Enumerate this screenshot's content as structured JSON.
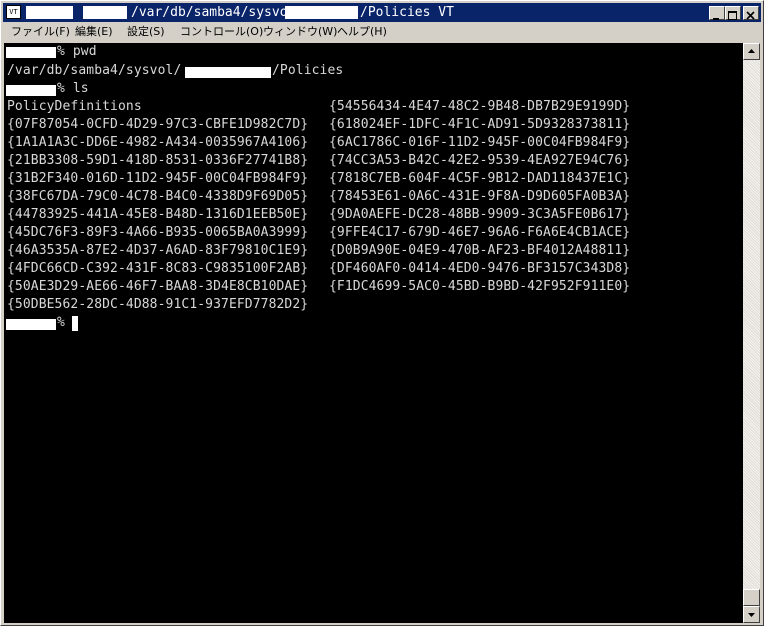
{
  "window": {
    "icon_label": "VT",
    "title_part1": "/var/db/samba4/sysvol/",
    "title_part2": "/Policies VT"
  },
  "menu": {
    "file": "ファイル(F)",
    "edit": "編集(E)",
    "settings": "設定(S)",
    "control": "コントロール(O)",
    "window": "ウィンドウ(W)",
    "help": "ヘルプ(H)"
  },
  "terminal": {
    "prompt1": "% pwd",
    "pwd_part1": "/var/db/samba4/sysvol/",
    "pwd_part2": "/Policies",
    "prompt2": "% ls",
    "prompt3": "%",
    "left_col": [
      "PolicyDefinitions",
      "{07F87054-0CFD-4D29-97C3-CBFE1D982C7D}",
      "{1A1A1A3C-DD6E-4982-A434-0035967A4106}",
      "{21BB3308-59D1-418D-8531-0336F27741B8}",
      "{31B2F340-016D-11D2-945F-00C04FB984F9}",
      "{38FC67DA-79C0-4C78-B4C0-4338D9F69D05}",
      "{44783925-441A-45E8-B48D-1316D1EEB50E}",
      "{45DC76F3-89F3-4A66-B935-0065BA0A3999}",
      "{46A3535A-87E2-4D37-A6AD-83F79810C1E9}",
      "{4FDC66CD-C392-431F-8C83-C9835100F2AB}",
      "{50AE3D29-AE66-46F7-BAA8-3D4E8CB10DAE}",
      "{50DBE562-28DC-4D88-91C1-937EFD7782D2}"
    ],
    "right_col": [
      "{54556434-4E47-48C2-9B48-DB7B29E9199D}",
      "{618024EF-1DFC-4F1C-AD91-5D9328373811}",
      "{6AC1786C-016F-11D2-945F-00C04FB984F9}",
      "{74CC3A53-B42C-42E2-9539-4EA927E94C76}",
      "{7818C7EB-604F-4C5F-9B12-DAD118437E1C}",
      "{78453E61-0A6C-431E-9F8A-D9D605FA0B3A}",
      "{9DA0AEFE-DC28-48BB-9909-3C3A5FE0B617}",
      "{9FFE4C17-679D-46E7-96A6-F6A6E4CB1ACE}",
      "{D0B9A90E-04E9-470B-AF23-BF4012A48811}",
      "{DF460AF0-0414-4ED0-9476-BF3157C343D8}",
      "{F1DC4699-5AC0-45BD-B9BD-42F952F911E0}"
    ]
  }
}
